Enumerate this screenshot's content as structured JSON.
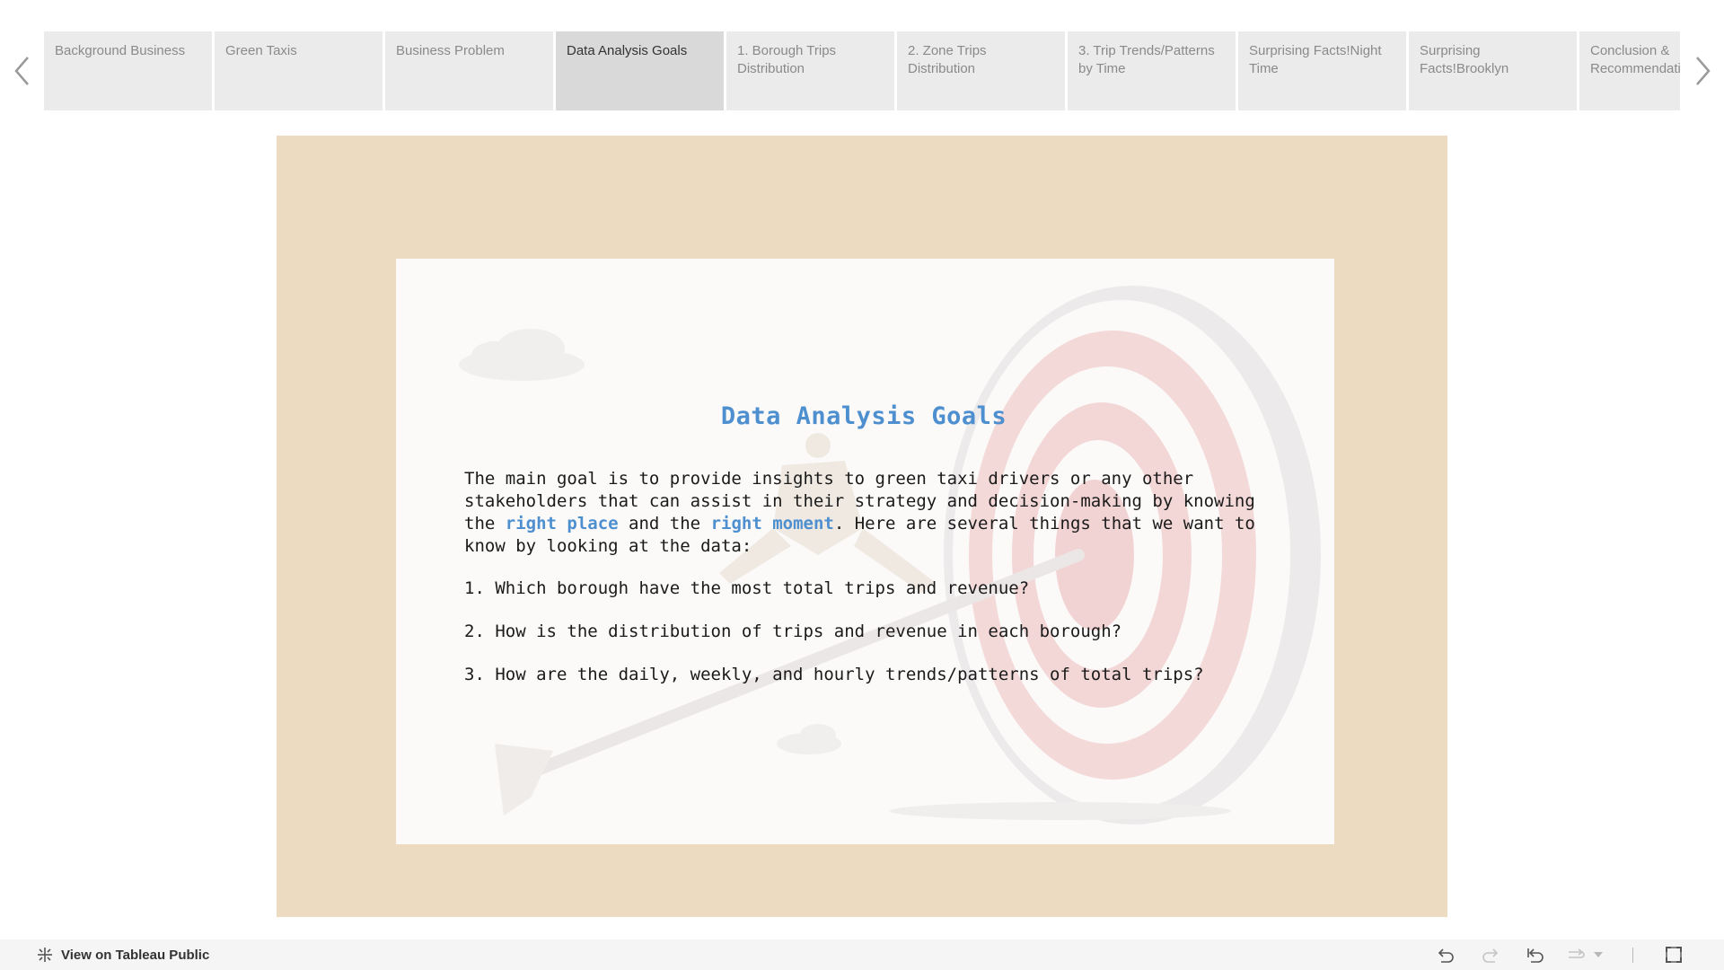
{
  "story": {
    "tabs": [
      {
        "label": "Background Business",
        "active": false
      },
      {
        "label": "Green Taxis",
        "active": false
      },
      {
        "label": "Business Problem",
        "active": false
      },
      {
        "label": "Data Analysis Goals",
        "active": true
      },
      {
        "label": "1. Borough Trips Distribution",
        "active": false
      },
      {
        "label": "2. Zone Trips Distribution",
        "active": false
      },
      {
        "label": "3. Trip Trends/Patterns by Time",
        "active": false
      },
      {
        "label": "Surprising Facts!Night Time",
        "active": false
      },
      {
        "label": "Surprising Facts!Brooklyn",
        "active": false
      },
      {
        "label": "Conclusion & Recommendations",
        "active": false
      }
    ],
    "prev_icon": "chevron-left-icon",
    "next_icon": "chevron-right-icon"
  },
  "goals": {
    "title": "Data Analysis Goals",
    "intro_before": "The main goal is to provide insights to green taxi drivers or any other stakeholders that can assist in their strategy and decision-making by knowing the ",
    "highlight_1": "right place",
    "intro_mid": " and the ",
    "highlight_2": "right moment",
    "intro_after": ". Here are several things that we want to know by looking at the data:",
    "questions": [
      "1. Which borough have the most total trips and revenue?",
      "2. How is the distribution of trips and revenue in each borough?",
      "3. How are the daily, weekly, and hourly trends/patterns of total trips?"
    ],
    "highlight_color": "#4e8fcf",
    "background_color": "#ecdbc1"
  },
  "footer": {
    "view_link": "View on Tableau Public",
    "toolbar_icons": [
      "undo-icon",
      "redo-icon",
      "revert-icon",
      "pause-icon",
      "dropdown-icon",
      "fullscreen-icon"
    ]
  }
}
